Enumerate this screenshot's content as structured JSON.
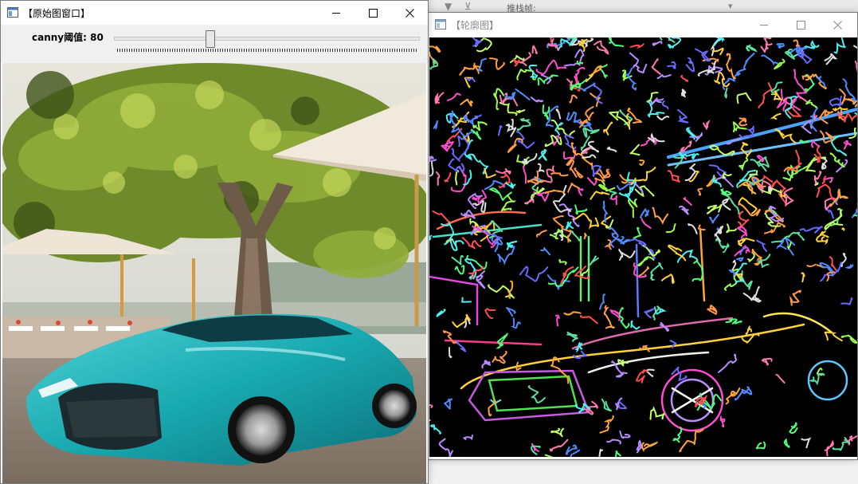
{
  "windows": {
    "original": {
      "title": "【原始图窗口】",
      "trackbar": {
        "label": "canny阈值: 80",
        "value": 80,
        "max": 255
      }
    },
    "contours": {
      "title": "【轮廓图】"
    }
  },
  "background": {
    "strip_text": "推栈帧:",
    "icons": [
      "funnel-icon",
      "funnel-clear-icon",
      "dropdown-arrow-icon"
    ]
  },
  "colors": {
    "car": "#19a9b0",
    "canvas_background": "#000000",
    "titlebar": "#ffffff",
    "window_frame": "#f0f0f0"
  }
}
